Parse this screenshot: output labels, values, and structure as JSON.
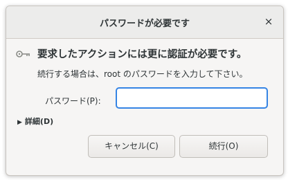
{
  "window": {
    "title": "パスワードが必要です",
    "close_glyph": "×"
  },
  "message": {
    "heading": "要求したアクションには更に認証が必要です。",
    "description": "続行する場合は、root のパスワードを入力して下さい。"
  },
  "password": {
    "label": "パスワード(P):",
    "value": "",
    "placeholder": ""
  },
  "details": {
    "label": "詳細(D)",
    "expanded": false
  },
  "buttons": {
    "cancel_label": "キャンセル(C)",
    "continue_label": "続行(O)"
  },
  "icons": {
    "prompt_icon": "key-icon",
    "details_arrow": "triangle-right-icon"
  },
  "colors": {
    "accent": "#3584e4",
    "text": "#2e3436",
    "background": "#f6f5f4"
  }
}
